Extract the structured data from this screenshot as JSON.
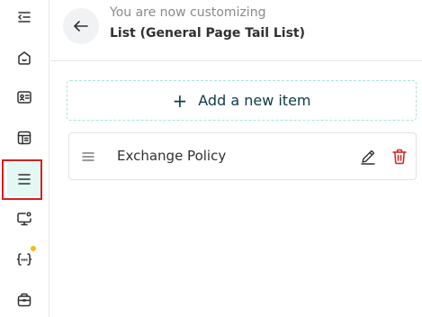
{
  "sidebar": {
    "items": [
      {
        "icon": "collapse-menu-icon"
      },
      {
        "icon": "home-icon"
      },
      {
        "icon": "id-card-icon"
      },
      {
        "icon": "layout-icon"
      },
      {
        "icon": "list-icon",
        "active": true
      },
      {
        "icon": "monitor-settings-icon"
      },
      {
        "icon": "code-braces-icon",
        "badge_color": "#f5b91a"
      },
      {
        "icon": "database-icon"
      }
    ],
    "active_color": "#e3f7f3",
    "highlight_color": "#d81e1e"
  },
  "header": {
    "subtitle": "You are now customizing",
    "title": "List (General Page Tail List)"
  },
  "add_item": {
    "plus": "+",
    "label": "Add a new item"
  },
  "list": {
    "items": [
      {
        "label": "Exchange Policy"
      }
    ]
  },
  "colors": {
    "accent_border": "#a8e6d6",
    "accent_text": "#0b3b48",
    "delete": "#d81e1e"
  }
}
